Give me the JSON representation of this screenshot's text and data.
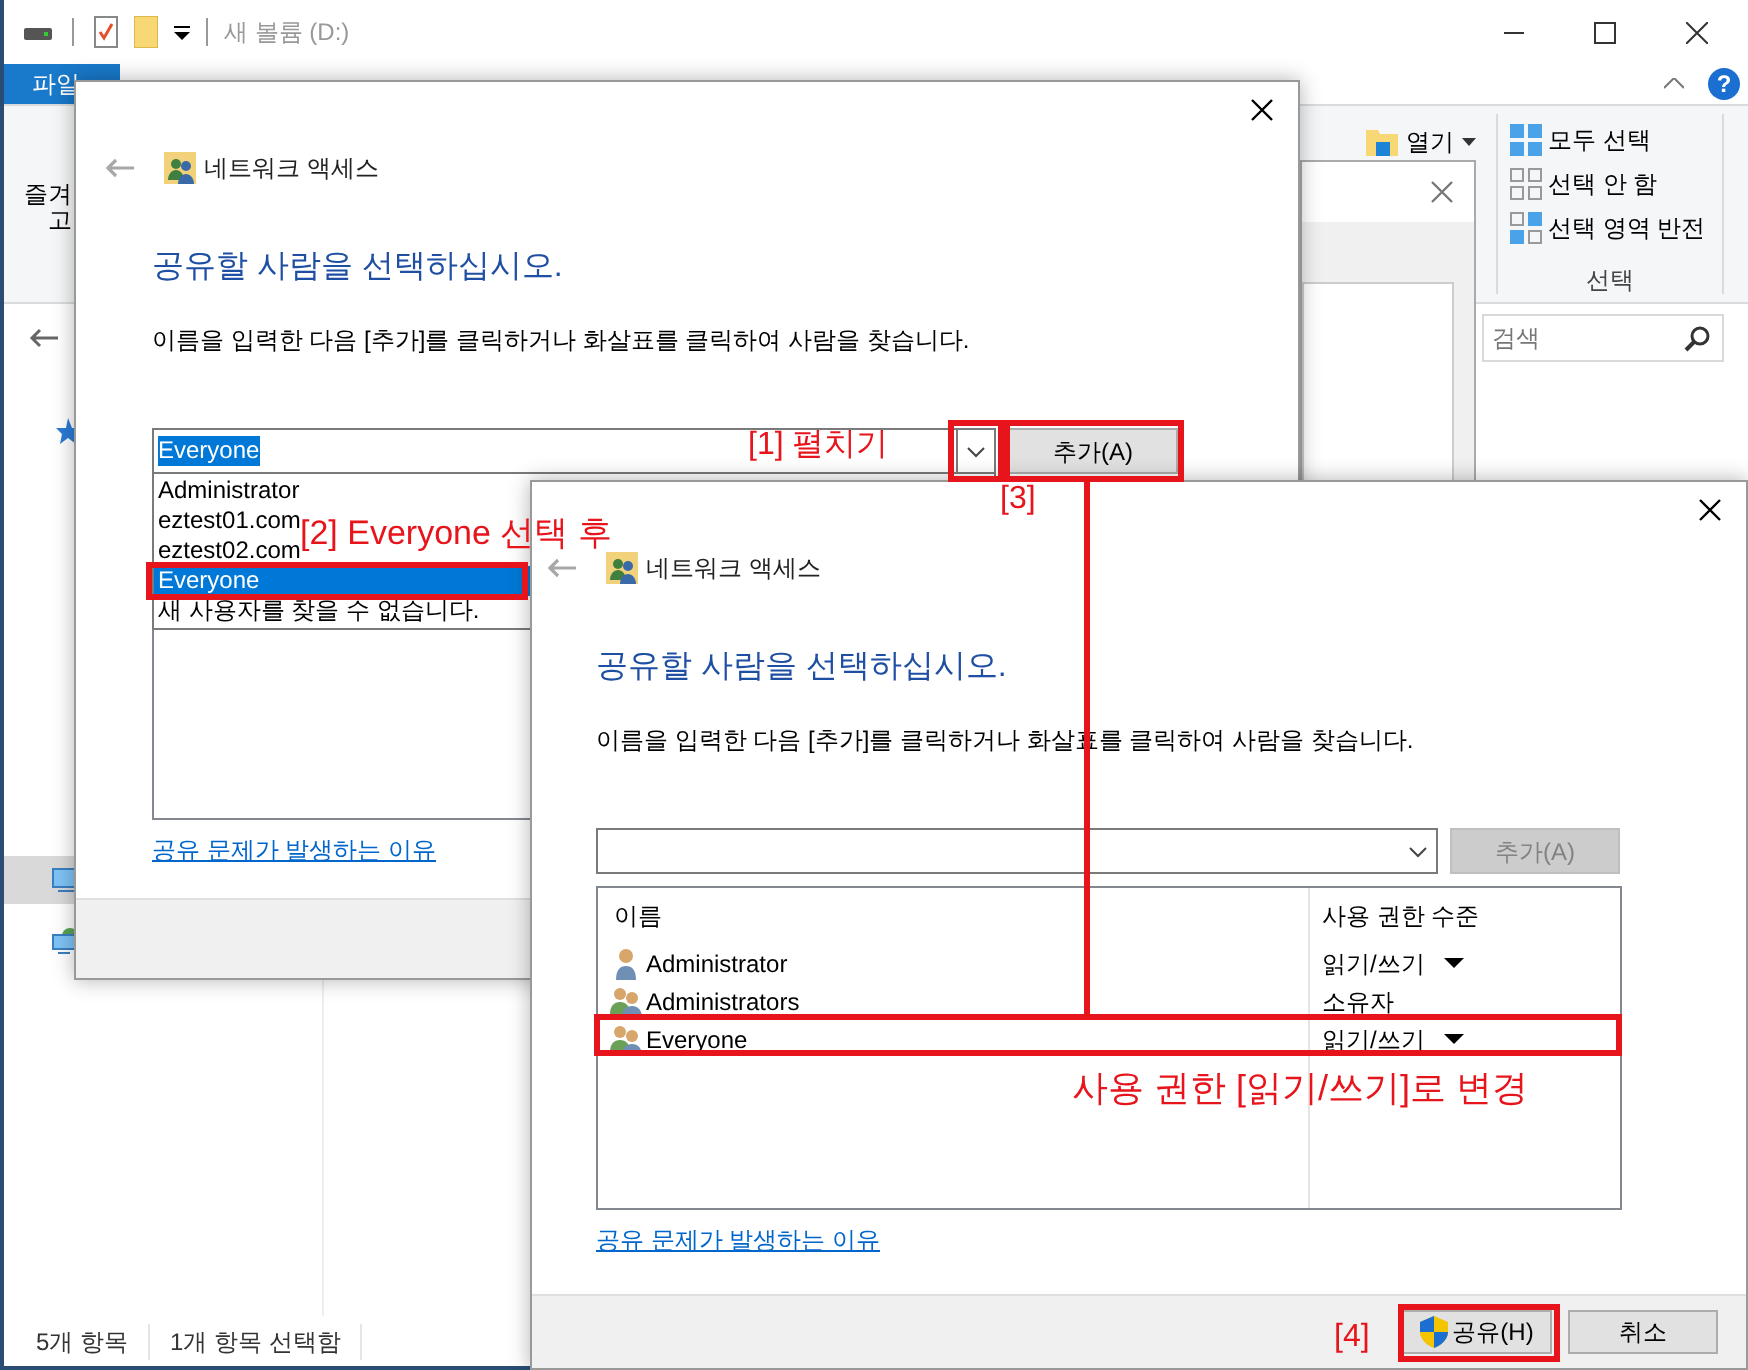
{
  "explorer": {
    "title": "새 볼륨 (D:)",
    "file_tab": "파일",
    "help_glyph": "?",
    "pin_label": [
      "즐겨",
      "고"
    ],
    "open_button": "열기",
    "select_items": [
      {
        "kind": "all",
        "label": "모두 선택"
      },
      {
        "kind": "none",
        "label": "선택 안 함"
      },
      {
        "kind": "invert",
        "label": "선택 영역 반전"
      }
    ],
    "select_group_label": "선택",
    "search_placeholder": "검색",
    "status_bar": [
      "5개 항목",
      "1개 항목 선택함"
    ]
  },
  "dialogs": [
    {
      "title": "네트워크 액세스",
      "heading": "공유할 사람을 선택하십시오.",
      "instruction": "이름을 입력한 다음 [추가]를 클릭하거나 화살표를 클릭하여 사람을 찾습니다.",
      "name_field": {
        "value": "Everyone",
        "value_selected": true
      },
      "add_button": {
        "label": "추가(A)",
        "disabled": false
      },
      "dropdown": {
        "items": [
          {
            "label": "Administrator",
            "selected": false
          },
          {
            "label": "eztest01.com",
            "selected": false
          },
          {
            "label": "eztest02.com",
            "selected": false
          },
          {
            "label": "Everyone",
            "selected": true
          }
        ],
        "message": "새 사용자를 찾을 수 없습니다."
      },
      "link": "공유 문제가 발생하는 이유"
    },
    {
      "title": "네트워크 액세스",
      "heading": "공유할 사람을 선택하십시오.",
      "instruction": "이름을 입력한 다음 [추가]를 클릭하거나 화살표를 클릭하여 사람을 찾습니다.",
      "add_button": {
        "label": "추가(A)",
        "disabled": true
      },
      "list": {
        "columns": [
          "이름",
          "사용 권한 수준"
        ],
        "rows": [
          {
            "kind": "user",
            "name": "Administrator",
            "permission": "읽기/쓰기",
            "has_menu": true
          },
          {
            "kind": "group",
            "name": "Administrators",
            "permission": "소유자",
            "has_menu": false
          },
          {
            "kind": "group",
            "name": "Everyone",
            "permission": "읽기/쓰기",
            "has_menu": true
          }
        ]
      },
      "link": "공유 문제가 발생하는 이유",
      "buttons": [
        {
          "kind": "share",
          "label": "공유(H)"
        },
        {
          "kind": "plain",
          "label": "취소"
        }
      ]
    }
  ],
  "annotations": [
    "[1] 펼치기",
    "[2] Everyone 선택 후",
    "[3]",
    "사용 권한 [읽기/쓰기]로 변경",
    "[4]"
  ]
}
